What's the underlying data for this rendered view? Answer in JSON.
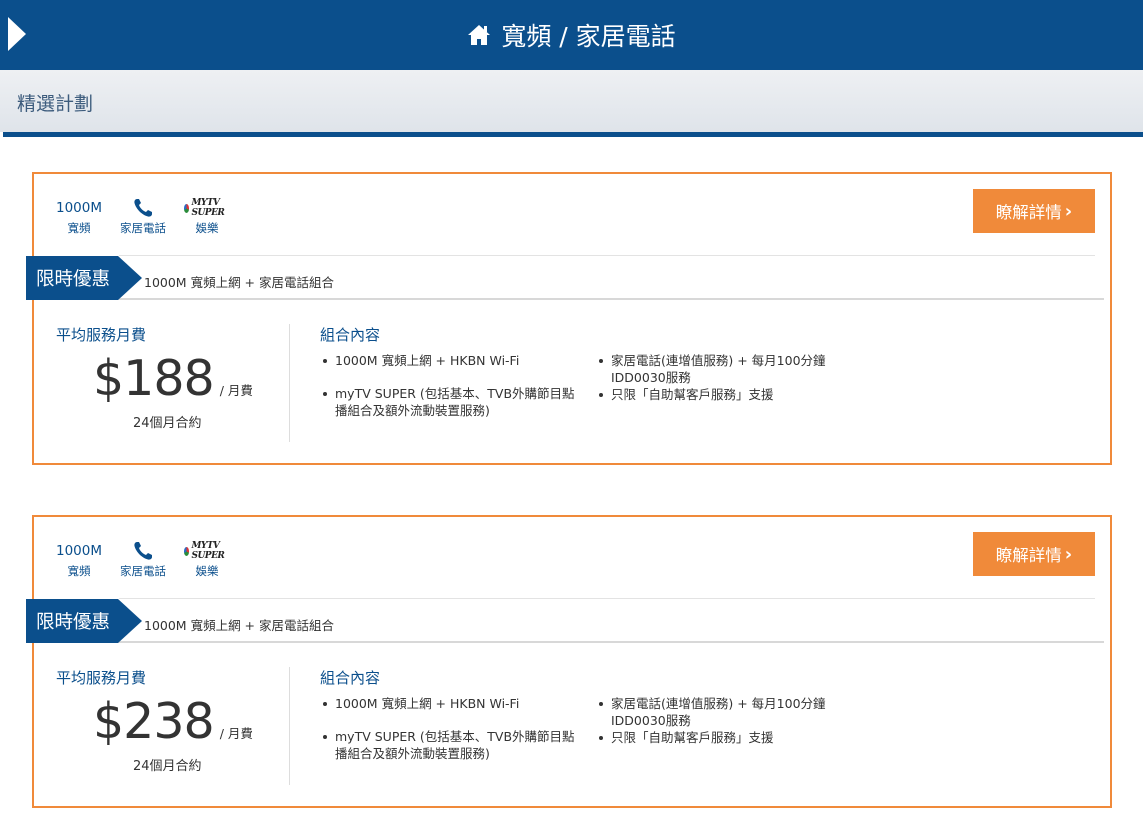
{
  "header": {
    "title": "寬頻 / 家居電話"
  },
  "subheader": {
    "label": "精選計劃"
  },
  "plans": [
    {
      "features": [
        {
          "top": "1000M",
          "label": "寬頻"
        },
        {
          "label": "家居電話",
          "icon": "phone-icon"
        },
        {
          "label": "娛樂",
          "icon": "mytv-super-logo"
        }
      ],
      "logo_text": "MYTV SUPER",
      "detail_button": "瞭解詳情",
      "promo_tag": "限時優惠",
      "promo_text": "1000M 寬頻上網 + 家居電話組合",
      "price_title": "平均服務月費",
      "price": "$188",
      "price_unit": "/ 月費",
      "contract": "24個月合約",
      "bundle_title": "組合內容",
      "bundle_items": [
        "1000M 寬頻上網 + HKBN Wi-Fi",
        "myTV SUPER (包括基本、TVB外購節目點播組合及額外流動裝置服務)",
        "家居電話(連增值服務) + 每月100分鐘IDD0030服務",
        "只限「自助幫客戶服務」支援"
      ]
    },
    {
      "features": [
        {
          "top": "1000M",
          "label": "寬頻"
        },
        {
          "label": "家居電話",
          "icon": "phone-icon"
        },
        {
          "label": "娛樂",
          "icon": "mytv-super-logo"
        }
      ],
      "logo_text": "MYTV SUPER",
      "detail_button": "瞭解詳情",
      "promo_tag": "限時優惠",
      "promo_text": "1000M 寬頻上網 + 家居電話組合",
      "price_title": "平均服務月費",
      "price": "$238",
      "price_unit": "/ 月費",
      "contract": "24個月合約",
      "bundle_title": "組合內容",
      "bundle_items": [
        "1000M 寬頻上網 + HKBN Wi-Fi",
        "myTV SUPER (包括基本、TVB外購節目點播組合及額外流動裝置服務)",
        "家居電話(連增值服務) + 每月100分鐘IDD0030服務",
        "只限「自助幫客戶服務」支援"
      ]
    }
  ],
  "colors": {
    "brand_blue": "#0b4f8c",
    "accent_orange": "#f08a3a"
  }
}
